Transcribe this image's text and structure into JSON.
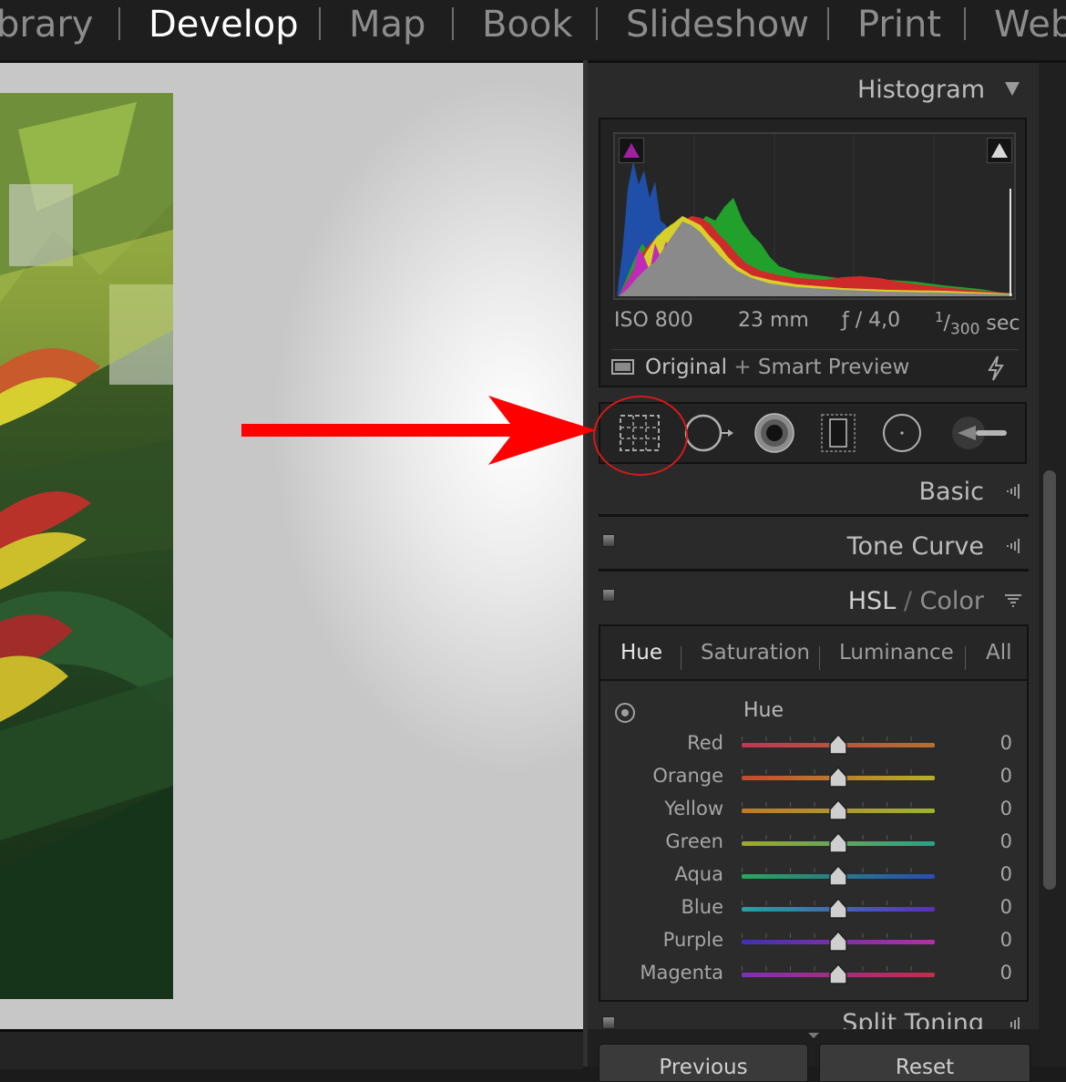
{
  "modules": [
    {
      "label": "brary",
      "active": false
    },
    {
      "label": "Develop",
      "active": true
    },
    {
      "label": "Map",
      "active": false
    },
    {
      "label": "Book",
      "active": false
    },
    {
      "label": "Slideshow",
      "active": false
    },
    {
      "label": "Print",
      "active": false
    },
    {
      "label": "Web",
      "active": false
    }
  ],
  "histogram": {
    "title": "Histogram",
    "exif": {
      "iso": "ISO 800",
      "focal": "23 mm",
      "aperture": "ƒ / 4,0",
      "shutter_num": "1",
      "shutter_den": "300",
      "shutter_unit": "sec"
    },
    "preview_original": "Original",
    "preview_sep": " + ",
    "preview_smart": "Smart Preview"
  },
  "tools": [
    "crop-overlay",
    "spot-removal",
    "red-eye",
    "graduated-filter",
    "radial-filter",
    "adjustment-brush"
  ],
  "panels": {
    "basic": "Basic",
    "tone_curve": "Tone Curve",
    "hsl_a": "HSL",
    "hsl_slash": " / ",
    "hsl_b": "Color",
    "split_toning": "Split Toning"
  },
  "hsl": {
    "tabs": [
      "Hue",
      "Saturation",
      "Luminance",
      "All"
    ],
    "active_tab": "Hue",
    "group_title": "Hue",
    "sliders": [
      {
        "label": "Red",
        "value": "0",
        "from": "#c23456",
        "to": "#b5712c"
      },
      {
        "label": "Orange",
        "value": "0",
        "from": "#c24a2c",
        "to": "#b4b12c"
      },
      {
        "label": "Yellow",
        "value": "0",
        "from": "#c07a24",
        "to": "#9cb52e"
      },
      {
        "label": "Green",
        "value": "0",
        "from": "#a0a82e",
        "to": "#2aa088"
      },
      {
        "label": "Aqua",
        "value": "0",
        "from": "#2aa85a",
        "to": "#2a4cb5"
      },
      {
        "label": "Blue",
        "value": "0",
        "from": "#2aa0a0",
        "to": "#5a30b5"
      },
      {
        "label": "Purple",
        "value": "0",
        "from": "#4030b5",
        "to": "#b530a0"
      },
      {
        "label": "Magenta",
        "value": "0",
        "from": "#8030b5",
        "to": "#c22e4a"
      }
    ]
  },
  "buttons": {
    "previous": "Previous",
    "reset": "Reset"
  },
  "colors": {
    "annotation": "#ff0000",
    "active_module": "#ffffff"
  }
}
